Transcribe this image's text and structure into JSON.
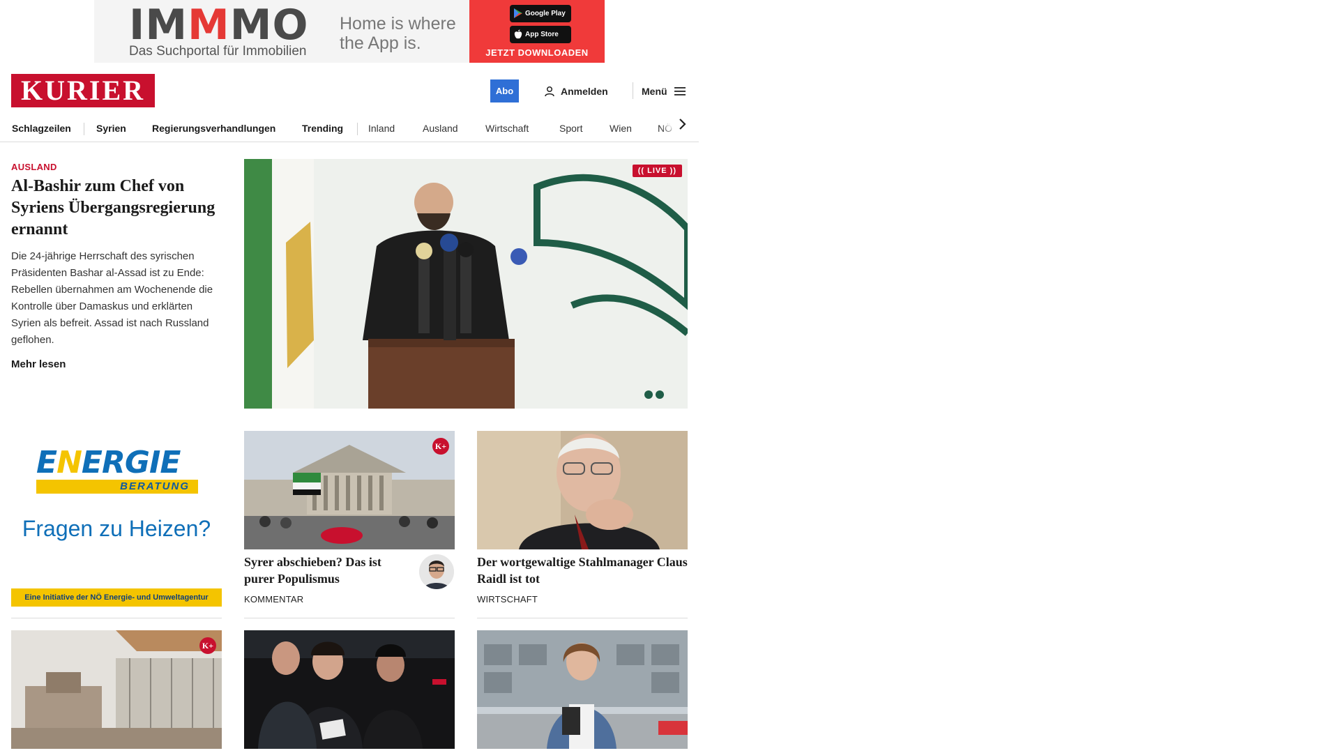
{
  "ad_top": {
    "logo_pre": "IM",
    "logo_mid": "M",
    "logo_post": "MO",
    "tagline": "Das Suchportal für Immobilien",
    "slogan": "Home is where the App is.",
    "google_play": "Google Play",
    "app_store": "App Store",
    "cta": "JETZT DOWNLOADEN"
  },
  "header": {
    "brand": "KURIER",
    "abo": "Abo",
    "login": "Anmelden",
    "menu": "Menü"
  },
  "nav": {
    "items": [
      "Schlagzeilen",
      "Syrien",
      "Regierungsverhandlungen",
      "Trending",
      "Inland",
      "Ausland",
      "Wirtschaft",
      "Sport",
      "Wien",
      "NÖ"
    ]
  },
  "lead": {
    "category": "AUSLAND",
    "title": "Al-Bashir zum Chef von Syriens Übergangsregie­rung ernannt",
    "text": "Die 24-jährige Herrschaft des syrischen Präsidenten Bashar al-Assad ist zu Ende: Rebellen übernahmen am Wochenende die Kontrolle über Damaskus und erklärten Syrien als befreit. Assad ist nach Russland geflohen.",
    "more": "Mehr lesen",
    "live": "LIVE"
  },
  "ad_side": {
    "brand_pre": "E",
    "brand_y": "N",
    "brand_post": "ERGIE",
    "brand_sub": "BERATUNG",
    "question": "Fragen zu Heizen?",
    "footer": "Eine Initiative der NÖ Energie- und Umweltagentur"
  },
  "cards": [
    {
      "title": "Syrer abschieben? Das ist purer Populismus",
      "category": "KOMMENTAR",
      "badge": "K+"
    },
    {
      "title": "Der wortgewaltige Stahlmanager Claus Raidl ist tot",
      "category": "WIRTSCHAFT"
    }
  ],
  "bottom_cards": [
    {
      "badge": "K+"
    }
  ],
  "colors": {
    "brand_red": "#c8102e",
    "abo_blue": "#2f6fd6",
    "ad_red": "#f03a3a",
    "energie_blue": "#0f6fb8",
    "energie_yellow": "#f4c400"
  },
  "icons": [
    "user-icon",
    "hamburger-menu-icon",
    "chevron-right-icon",
    "google-play-icon",
    "apple-icon"
  ]
}
